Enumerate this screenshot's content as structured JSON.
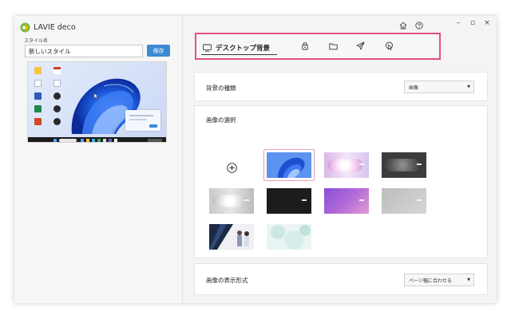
{
  "app": {
    "name": "LAVIE deco"
  },
  "left_panel": {
    "style_name_label": "スタイル名",
    "style_name_value": "新しいスタイル",
    "save_label": "保存"
  },
  "tabs": [
    {
      "label": "デスクトップ背景",
      "icon": "monitor-icon",
      "active": true
    },
    {
      "icon": "lock-icon"
    },
    {
      "icon": "folder-icon"
    },
    {
      "icon": "send-icon"
    },
    {
      "icon": "cursor-icon"
    }
  ],
  "window_controls": {
    "minimize": "–",
    "maximize": "▫",
    "close": "×"
  },
  "header_icons": [
    "home-icon",
    "help-icon"
  ],
  "settings": {
    "background_type": {
      "label": "背景の種類",
      "value": "画像"
    },
    "image_select": {
      "label": "画像の選択"
    },
    "display_format": {
      "label": "画像の表示形式",
      "value": "ページ幅に合わせる"
    }
  },
  "thumbnails": [
    {
      "name": "bloom-blue",
      "selected": true
    },
    {
      "name": "pink-glow"
    },
    {
      "name": "dark-gray-glow"
    },
    {
      "name": "silver-glow"
    },
    {
      "name": "black"
    },
    {
      "name": "purple-gradient"
    },
    {
      "name": "light-gray"
    },
    {
      "name": "people-dark"
    },
    {
      "name": "mint-circles"
    }
  ],
  "colors": {
    "accent": "#3b8bd1",
    "highlight_frame": "#e54e86",
    "taskbar": "#1c1c1c"
  }
}
